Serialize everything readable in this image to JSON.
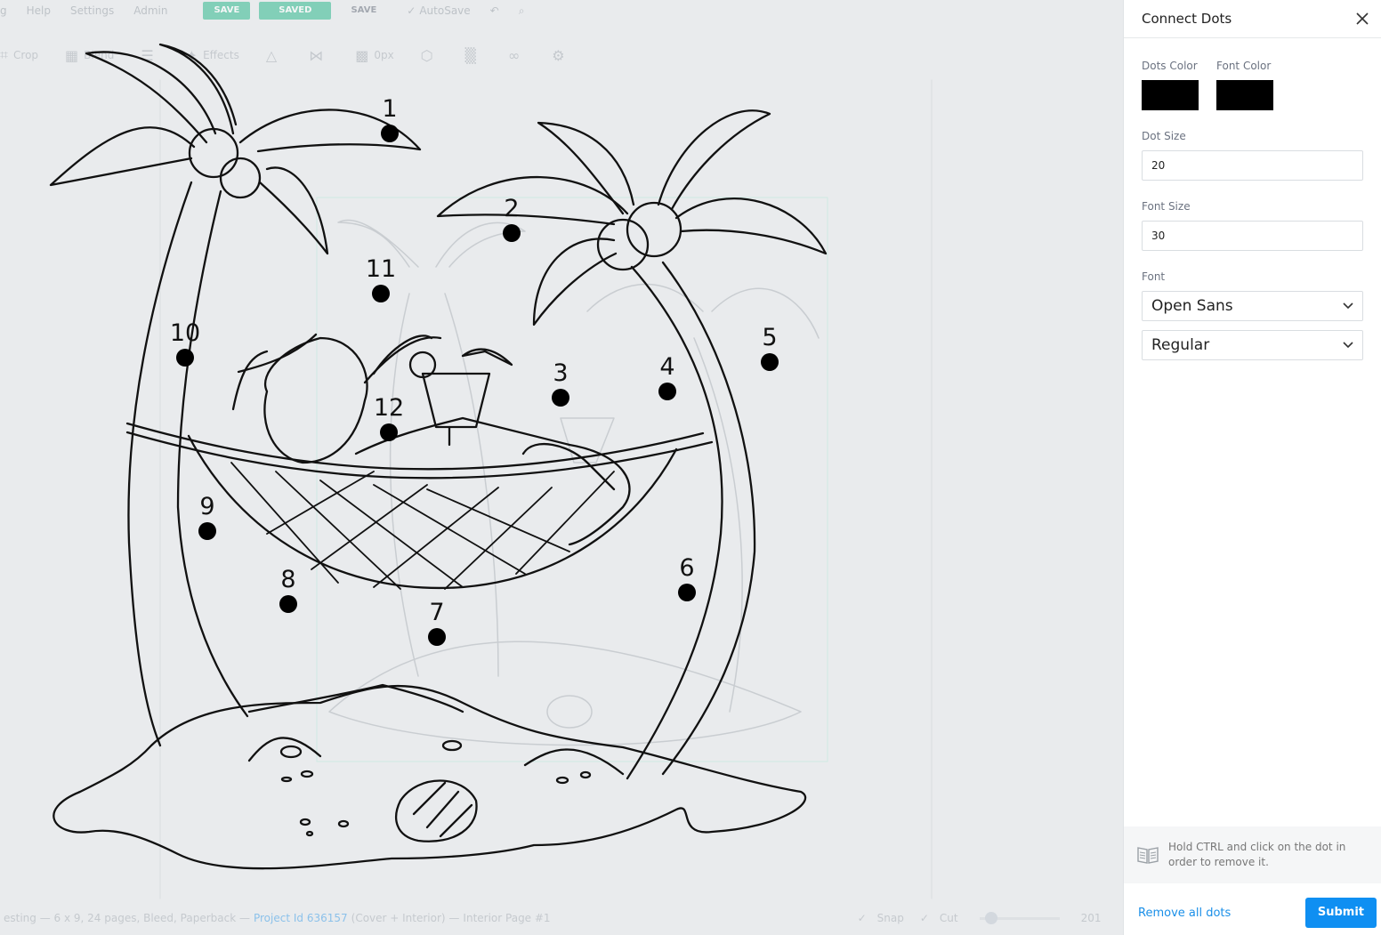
{
  "menubar": {
    "items": [
      "g",
      "Help",
      "Settings",
      "Admin"
    ],
    "buttons": [
      "SAVE",
      "SAVED",
      "SAVE"
    ],
    "autosave": "AutoSave"
  },
  "toolbar": {
    "items": [
      "Crop",
      "Blend",
      "Effects",
      "0px"
    ]
  },
  "statusbar": {
    "text": "esting — 6 x 9, 24 pages, Bleed, Paperback —",
    "project": "Project Id 636157",
    "context": "(Cover + Interior) —",
    "page": "Interior Page #1",
    "snap": "Snap",
    "cut": "Cut",
    "zoom": "201"
  },
  "dots": [
    {
      "n": "1"
    },
    {
      "n": "2"
    },
    {
      "n": "3"
    },
    {
      "n": "4"
    },
    {
      "n": "5"
    },
    {
      "n": "6"
    },
    {
      "n": "7"
    },
    {
      "n": "8"
    },
    {
      "n": "9"
    },
    {
      "n": "10"
    },
    {
      "n": "11"
    },
    {
      "n": "12"
    }
  ],
  "panel": {
    "title": "Connect Dots",
    "dots_color_label": "Dots Color",
    "dots_color": "#000000",
    "font_color_label": "Font Color",
    "font_color": "#000000",
    "dot_size_label": "Dot Size",
    "dot_size": "20",
    "font_size_label": "Font Size",
    "font_size": "30",
    "font_label": "Font",
    "font_family": "Open Sans",
    "font_weight": "Regular",
    "hint": "Hold CTRL and click on the dot in order to remove it.",
    "remove_all": "Remove all dots",
    "submit": "Submit"
  },
  "colors": {
    "accent": "#0f8ff2",
    "link": "#1a8fe8",
    "canvas_bg": "#e9ebed"
  }
}
